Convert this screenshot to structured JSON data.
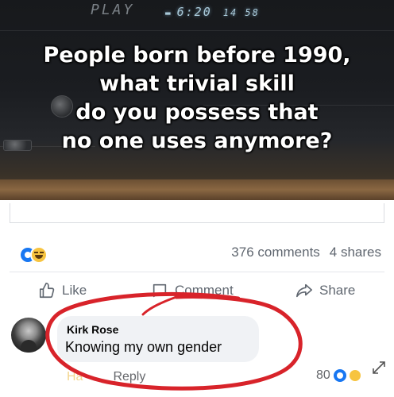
{
  "meme": {
    "display_mode": "PLAY",
    "display_time": "6:20",
    "display_seconds": "14 58",
    "headline_lines": [
      "People born before 1990,",
      "what trivial skill",
      "do you possess that",
      "no one uses anymore?"
    ]
  },
  "post": {
    "reaction_icons": [
      "like-reaction-icon",
      "haha-reaction-icon"
    ],
    "comments_count": "376 comments",
    "shares_count": "4 shares",
    "actions": {
      "like": "Like",
      "comment": "Comment",
      "share": "Share"
    }
  },
  "comment": {
    "author": "Kirk Rose",
    "text": "Knowing my own gender",
    "haha_link": "Ha",
    "reply": "Reply",
    "reaction_count": "80"
  },
  "colors": {
    "facebook_blue": "#1877f2",
    "haha_yellow": "#f7c440",
    "highlight_red": "#d8232a",
    "muted_text": "#606770"
  }
}
